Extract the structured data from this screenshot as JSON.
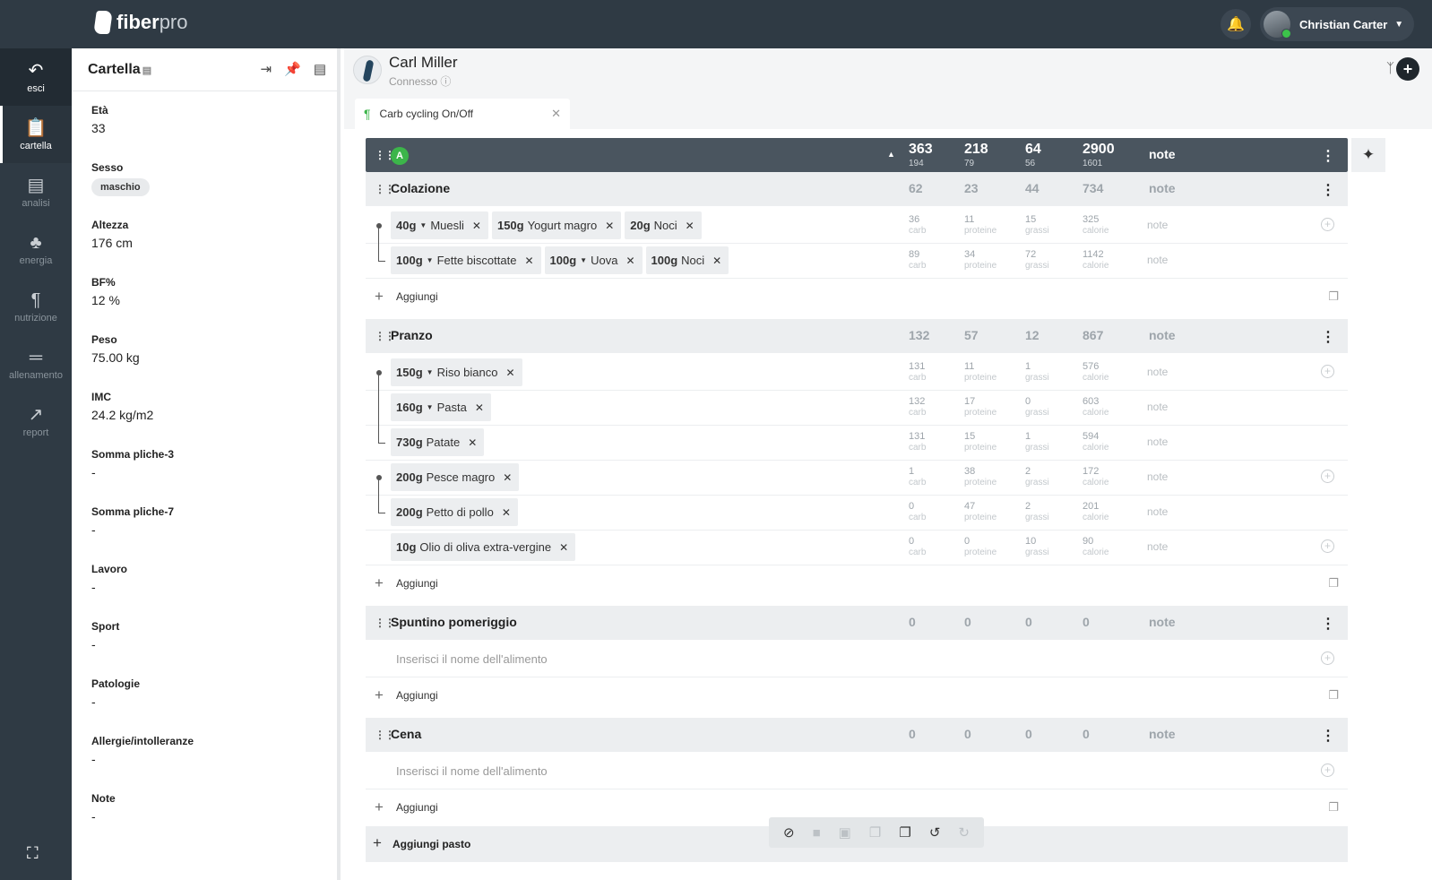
{
  "app": {
    "brand_main": "fiber",
    "brand_accent": "pro",
    "user_name": "Christian Carter"
  },
  "nav": [
    {
      "id": "esci",
      "label": "esci",
      "icon": "back-arrow-icon"
    },
    {
      "id": "cartella",
      "label": "cartella",
      "icon": "clipboard-icon"
    },
    {
      "id": "analisi",
      "label": "analisi",
      "icon": "document-icon"
    },
    {
      "id": "energia",
      "label": "energia",
      "icon": "flame-icon"
    },
    {
      "id": "nutrizione",
      "label": "nutrizione",
      "icon": "fork-knife-icon"
    },
    {
      "id": "allenamento",
      "label": "allenamento",
      "icon": "dumbbell-icon"
    },
    {
      "id": "report",
      "label": "report",
      "icon": "chart-icon"
    }
  ],
  "panel": {
    "title": "Cartella",
    "fields": [
      {
        "label": "Età",
        "value": "33"
      },
      {
        "label": "Sesso",
        "value": "maschio"
      },
      {
        "label": "Altezza",
        "value": "176 cm"
      },
      {
        "label": "BF%",
        "value": "12 %"
      },
      {
        "label": "Peso",
        "value": "75.00 kg"
      },
      {
        "label": "IMC",
        "value": "24.2 kg/m2"
      },
      {
        "label": "Somma pliche-3",
        "value": "-"
      },
      {
        "label": "Somma pliche-7",
        "value": "-"
      },
      {
        "label": "Lavoro",
        "value": "-"
      },
      {
        "label": "Sport",
        "value": "-"
      },
      {
        "label": "Patologie",
        "value": "-"
      },
      {
        "label": "Allergie/intolleranze",
        "value": "-"
      },
      {
        "label": "Note",
        "value": "-"
      }
    ]
  },
  "client": {
    "name": "Carl Miller",
    "status": "Connesso"
  },
  "tab": {
    "label": "Carb cycling On/Off"
  },
  "plan": {
    "badge": "A",
    "totals": [
      {
        "value": "363",
        "sub": "194"
      },
      {
        "value": "218",
        "sub": "79"
      },
      {
        "value": "64",
        "sub": "56"
      },
      {
        "value": "2900",
        "sub": "1601"
      }
    ],
    "note": "note"
  },
  "labels": {
    "carb": "carb",
    "proteine": "proteine",
    "grassi": "grassi",
    "calorie": "calorie",
    "note": "note",
    "add": "Aggiungi",
    "add_meal": "Aggiungi pasto",
    "food_placeholder": "Inserisci il nome dell'alimento"
  },
  "meals": [
    {
      "name": "Colazione",
      "totals": [
        "62",
        "23",
        "44",
        "734"
      ],
      "rows": [
        {
          "chips": [
            {
              "qty": "40g",
              "dd": true,
              "name": "Muesli"
            },
            {
              "qty": "150g",
              "dd": false,
              "name": "Yogurt magro"
            },
            {
              "qty": "20g",
              "dd": false,
              "name": "Noci"
            }
          ],
          "macros": [
            "36",
            "11",
            "15",
            "325"
          ]
        },
        {
          "chips": [
            {
              "qty": "100g",
              "dd": true,
              "name": "Fette biscottate"
            },
            {
              "qty": "100g",
              "dd": true,
              "name": "Uova"
            },
            {
              "qty": "100g",
              "dd": false,
              "name": "Noci"
            }
          ],
          "macros": [
            "89",
            "34",
            "72",
            "1142"
          ]
        }
      ]
    },
    {
      "name": "Pranzo",
      "totals": [
        "132",
        "57",
        "12",
        "867"
      ],
      "rows": [
        {
          "chips": [
            {
              "qty": "150g",
              "dd": true,
              "name": "Riso bianco"
            }
          ],
          "macros": [
            "131",
            "11",
            "1",
            "576"
          ]
        },
        {
          "chips": [
            {
              "qty": "160g",
              "dd": true,
              "name": "Pasta"
            }
          ],
          "macros": [
            "132",
            "17",
            "0",
            "603"
          ]
        },
        {
          "chips": [
            {
              "qty": "730g",
              "dd": false,
              "name": "Patate"
            }
          ],
          "macros": [
            "131",
            "15",
            "1",
            "594"
          ]
        },
        {
          "chips": [
            {
              "qty": "200g",
              "dd": false,
              "name": "Pesce magro"
            }
          ],
          "macros": [
            "1",
            "38",
            "2",
            "172"
          ]
        },
        {
          "chips": [
            {
              "qty": "200g",
              "dd": false,
              "name": "Petto di pollo"
            }
          ],
          "macros": [
            "0",
            "47",
            "2",
            "201"
          ]
        },
        {
          "chips": [
            {
              "qty": "10g",
              "dd": false,
              "name": "Olio di oliva extra-vergine"
            }
          ],
          "macros": [
            "0",
            "0",
            "10",
            "90"
          ]
        }
      ]
    },
    {
      "name": "Spuntino pomeriggio",
      "totals": [
        "0",
        "0",
        "0",
        "0"
      ],
      "rows": []
    },
    {
      "name": "Cena",
      "totals": [
        "0",
        "0",
        "0",
        "0"
      ],
      "rows": []
    }
  ]
}
